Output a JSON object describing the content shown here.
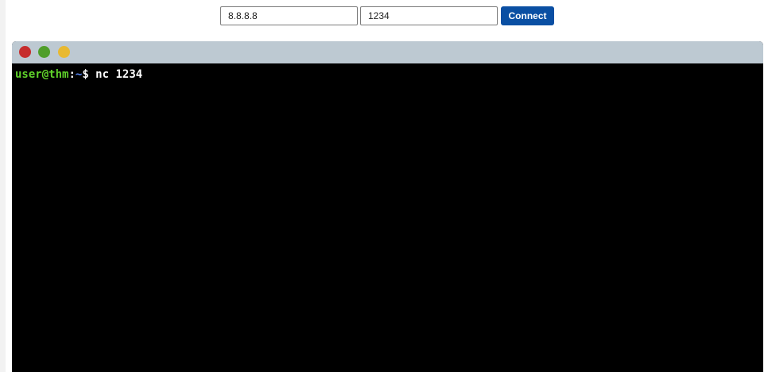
{
  "connection": {
    "ip_value": "8.8.8.8",
    "port_value": "1234",
    "connect_label": "Connect"
  },
  "terminal": {
    "window_controls": [
      "close-dot",
      "maximize-dot",
      "minimize-dot"
    ],
    "prompt_user": "user@thm",
    "prompt_sep": ":",
    "prompt_path": "~",
    "prompt_symbol": "$",
    "command": " nc 1234"
  },
  "colors": {
    "connect_button": "#0a4fa3",
    "titlebar": "#bdc9d2",
    "close_dot": "#c62d2d",
    "green_dot": "#4f9e2a",
    "yellow_dot": "#e8b931",
    "prompt_user": "#5fd22a",
    "prompt_path": "#5a8cff"
  }
}
